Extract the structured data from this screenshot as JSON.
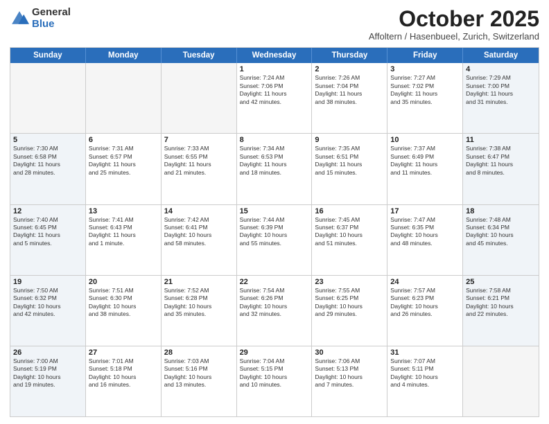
{
  "logo": {
    "general": "General",
    "blue": "Blue"
  },
  "header": {
    "month": "October 2025",
    "location": "Affoltern / Hasenbueel, Zurich, Switzerland"
  },
  "days": [
    "Sunday",
    "Monday",
    "Tuesday",
    "Wednesday",
    "Thursday",
    "Friday",
    "Saturday"
  ],
  "weeks": [
    [
      {
        "day": "",
        "info": "",
        "empty": true
      },
      {
        "day": "",
        "info": "",
        "empty": true
      },
      {
        "day": "",
        "info": "",
        "empty": true
      },
      {
        "day": "1",
        "info": "Sunrise: 7:24 AM\nSunset: 7:06 PM\nDaylight: 11 hours\nand 42 minutes.",
        "empty": false
      },
      {
        "day": "2",
        "info": "Sunrise: 7:26 AM\nSunset: 7:04 PM\nDaylight: 11 hours\nand 38 minutes.",
        "empty": false
      },
      {
        "day": "3",
        "info": "Sunrise: 7:27 AM\nSunset: 7:02 PM\nDaylight: 11 hours\nand 35 minutes.",
        "empty": false
      },
      {
        "day": "4",
        "info": "Sunrise: 7:29 AM\nSunset: 7:00 PM\nDaylight: 11 hours\nand 31 minutes.",
        "empty": false,
        "shaded": true
      }
    ],
    [
      {
        "day": "5",
        "info": "Sunrise: 7:30 AM\nSunset: 6:58 PM\nDaylight: 11 hours\nand 28 minutes.",
        "empty": false,
        "shaded": true
      },
      {
        "day": "6",
        "info": "Sunrise: 7:31 AM\nSunset: 6:57 PM\nDaylight: 11 hours\nand 25 minutes.",
        "empty": false
      },
      {
        "day": "7",
        "info": "Sunrise: 7:33 AM\nSunset: 6:55 PM\nDaylight: 11 hours\nand 21 minutes.",
        "empty": false
      },
      {
        "day": "8",
        "info": "Sunrise: 7:34 AM\nSunset: 6:53 PM\nDaylight: 11 hours\nand 18 minutes.",
        "empty": false
      },
      {
        "day": "9",
        "info": "Sunrise: 7:35 AM\nSunset: 6:51 PM\nDaylight: 11 hours\nand 15 minutes.",
        "empty": false
      },
      {
        "day": "10",
        "info": "Sunrise: 7:37 AM\nSunset: 6:49 PM\nDaylight: 11 hours\nand 11 minutes.",
        "empty": false
      },
      {
        "day": "11",
        "info": "Sunrise: 7:38 AM\nSunset: 6:47 PM\nDaylight: 11 hours\nand 8 minutes.",
        "empty": false,
        "shaded": true
      }
    ],
    [
      {
        "day": "12",
        "info": "Sunrise: 7:40 AM\nSunset: 6:45 PM\nDaylight: 11 hours\nand 5 minutes.",
        "empty": false,
        "shaded": true
      },
      {
        "day": "13",
        "info": "Sunrise: 7:41 AM\nSunset: 6:43 PM\nDaylight: 11 hours\nand 1 minute.",
        "empty": false
      },
      {
        "day": "14",
        "info": "Sunrise: 7:42 AM\nSunset: 6:41 PM\nDaylight: 10 hours\nand 58 minutes.",
        "empty": false
      },
      {
        "day": "15",
        "info": "Sunrise: 7:44 AM\nSunset: 6:39 PM\nDaylight: 10 hours\nand 55 minutes.",
        "empty": false
      },
      {
        "day": "16",
        "info": "Sunrise: 7:45 AM\nSunset: 6:37 PM\nDaylight: 10 hours\nand 51 minutes.",
        "empty": false
      },
      {
        "day": "17",
        "info": "Sunrise: 7:47 AM\nSunset: 6:35 PM\nDaylight: 10 hours\nand 48 minutes.",
        "empty": false
      },
      {
        "day": "18",
        "info": "Sunrise: 7:48 AM\nSunset: 6:34 PM\nDaylight: 10 hours\nand 45 minutes.",
        "empty": false,
        "shaded": true
      }
    ],
    [
      {
        "day": "19",
        "info": "Sunrise: 7:50 AM\nSunset: 6:32 PM\nDaylight: 10 hours\nand 42 minutes.",
        "empty": false,
        "shaded": true
      },
      {
        "day": "20",
        "info": "Sunrise: 7:51 AM\nSunset: 6:30 PM\nDaylight: 10 hours\nand 38 minutes.",
        "empty": false
      },
      {
        "day": "21",
        "info": "Sunrise: 7:52 AM\nSunset: 6:28 PM\nDaylight: 10 hours\nand 35 minutes.",
        "empty": false
      },
      {
        "day": "22",
        "info": "Sunrise: 7:54 AM\nSunset: 6:26 PM\nDaylight: 10 hours\nand 32 minutes.",
        "empty": false
      },
      {
        "day": "23",
        "info": "Sunrise: 7:55 AM\nSunset: 6:25 PM\nDaylight: 10 hours\nand 29 minutes.",
        "empty": false
      },
      {
        "day": "24",
        "info": "Sunrise: 7:57 AM\nSunset: 6:23 PM\nDaylight: 10 hours\nand 26 minutes.",
        "empty": false
      },
      {
        "day": "25",
        "info": "Sunrise: 7:58 AM\nSunset: 6:21 PM\nDaylight: 10 hours\nand 22 minutes.",
        "empty": false,
        "shaded": true
      }
    ],
    [
      {
        "day": "26",
        "info": "Sunrise: 7:00 AM\nSunset: 5:19 PM\nDaylight: 10 hours\nand 19 minutes.",
        "empty": false,
        "shaded": true
      },
      {
        "day": "27",
        "info": "Sunrise: 7:01 AM\nSunset: 5:18 PM\nDaylight: 10 hours\nand 16 minutes.",
        "empty": false
      },
      {
        "day": "28",
        "info": "Sunrise: 7:03 AM\nSunset: 5:16 PM\nDaylight: 10 hours\nand 13 minutes.",
        "empty": false
      },
      {
        "day": "29",
        "info": "Sunrise: 7:04 AM\nSunset: 5:15 PM\nDaylight: 10 hours\nand 10 minutes.",
        "empty": false
      },
      {
        "day": "30",
        "info": "Sunrise: 7:06 AM\nSunset: 5:13 PM\nDaylight: 10 hours\nand 7 minutes.",
        "empty": false
      },
      {
        "day": "31",
        "info": "Sunrise: 7:07 AM\nSunset: 5:11 PM\nDaylight: 10 hours\nand 4 minutes.",
        "empty": false
      },
      {
        "day": "",
        "info": "",
        "empty": true,
        "shaded": true
      }
    ]
  ]
}
